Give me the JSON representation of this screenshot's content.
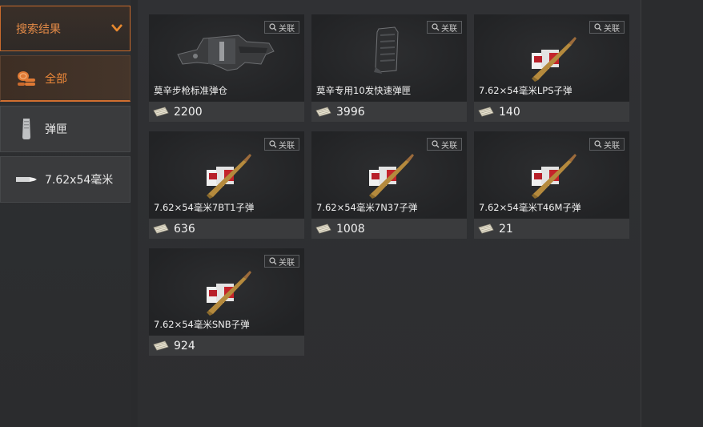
{
  "sidebar": {
    "search_header": "搜索结果",
    "categories": [
      {
        "label": "全部",
        "icon": "coins-icon",
        "active": true
      },
      {
        "label": "弹匣",
        "icon": "magazine-icon",
        "active": false
      },
      {
        "label": "7.62x54毫米",
        "icon": "bullet-icon",
        "active": false
      }
    ]
  },
  "items": [
    {
      "name": "莫辛步枪标准弹仓",
      "price": "2200",
      "assoc": "关联",
      "image": "rifle-magazine-block"
    },
    {
      "name": "莫辛专用10发快速弹匣",
      "price": "3996",
      "assoc": "关联",
      "image": "box-magazine"
    },
    {
      "name": "7.62×54毫米LPS子弹",
      "price": "140",
      "assoc": "关联",
      "image": "ammo-box-cartridge"
    },
    {
      "name": "7.62×54毫米7BT1子弹",
      "price": "636",
      "assoc": "关联",
      "image": "ammo-box-cartridge"
    },
    {
      "name": "7.62×54毫米7N37子弹",
      "price": "1008",
      "assoc": "关联",
      "image": "ammo-box-cartridge"
    },
    {
      "name": "7.62×54毫米T46M子弹",
      "price": "21",
      "assoc": "关联",
      "image": "ammo-box-cartridge"
    },
    {
      "name": "7.62×54毫米SNB子弹",
      "price": "924",
      "assoc": "关联",
      "image": "ammo-box-cartridge"
    }
  ],
  "colors": {
    "accent": "#e38a47",
    "active_underline": "#d06f30",
    "card_bg": "#252628",
    "price_bar": "#3a3b3d"
  }
}
